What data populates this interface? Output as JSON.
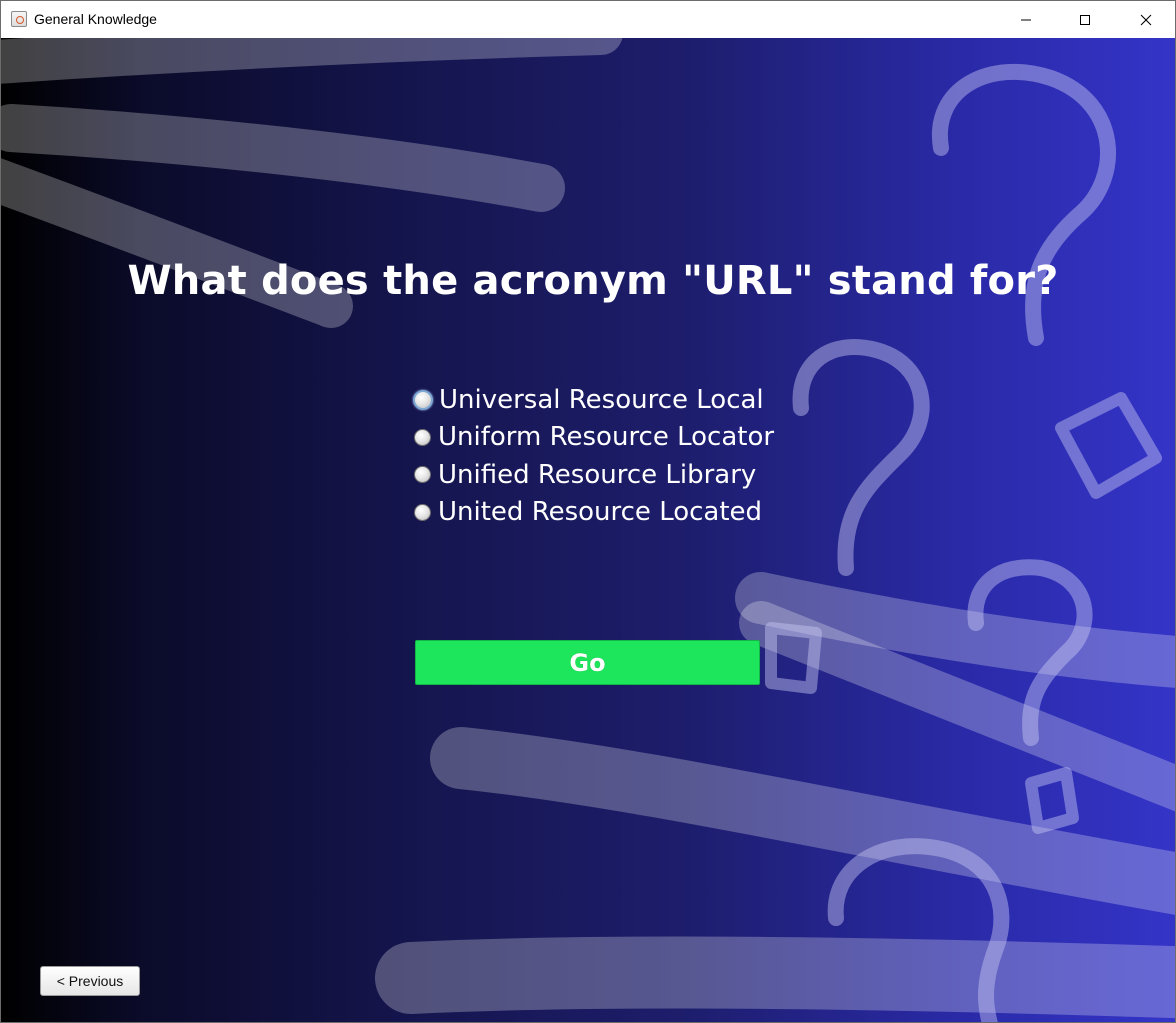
{
  "window": {
    "title": "General Knowledge",
    "controls": {
      "minimize_icon": "minimize-icon",
      "maximize_icon": "maximize-icon",
      "close_icon": "close-icon"
    }
  },
  "quiz": {
    "question": "What does the acronym \"URL\" stand for?",
    "options": [
      {
        "label": "Universal Resource Local",
        "selected": false,
        "focused": true
      },
      {
        "label": "Uniform Resource Locator",
        "selected": false,
        "focused": false
      },
      {
        "label": "Unified Resource Library",
        "selected": false,
        "focused": false
      },
      {
        "label": "United Resource Located",
        "selected": false,
        "focused": false
      }
    ],
    "go_label": "Go",
    "previous_label": "< Previous"
  },
  "colors": {
    "go_button": "#1de65c",
    "background_left": "#000000",
    "background_right": "#3434c8",
    "text": "#ffffff"
  }
}
